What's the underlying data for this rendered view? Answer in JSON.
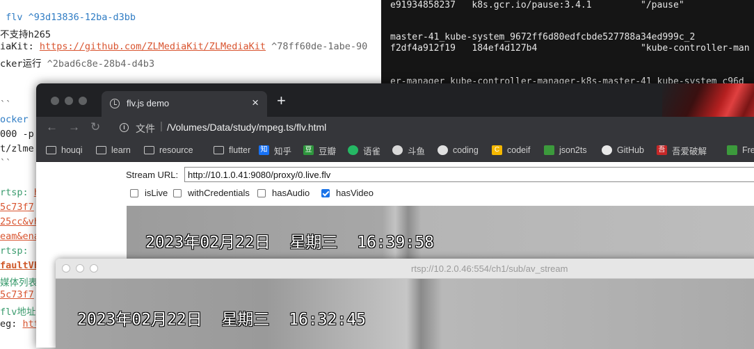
{
  "editor": {
    "lines": [
      {
        "segments": [
          {
            "text": " flv ^93d13836-12ba-d3bb",
            "style": "blue"
          }
        ]
      },
      {
        "segments": [
          {
            "text": "不支持h265",
            "style": "plain"
          }
        ]
      },
      {
        "segments": [
          {
            "text": "iaKit: ",
            "style": "plain"
          },
          {
            "text": "https://github.com/ZLMediaKit/ZLMediaKit",
            "style": "link"
          },
          {
            "text": " ^78ff60de-1abe-90",
            "style": "gray"
          }
        ]
      },
      {
        "segments": [
          {
            "text": "cker运行 ",
            "style": "plain"
          },
          {
            "text": "^2bad6c8e-28b4-d4b3",
            "style": "gray"
          }
        ]
      },
      {
        "segments": [
          {
            "text": "",
            "style": "plain"
          }
        ]
      },
      {
        "segments": [
          {
            "text": "",
            "style": "plain"
          }
        ]
      },
      {
        "segments": [
          {
            "text": "``",
            "style": "gray"
          }
        ]
      },
      {
        "segments": [
          {
            "text": "ocker",
            "style": "blue"
          }
        ]
      },
      {
        "segments": [
          {
            "text": "000 -p",
            "style": "plain"
          }
        ]
      },
      {
        "segments": [
          {
            "text": "t/zlme",
            "style": "plain"
          }
        ]
      },
      {
        "segments": [
          {
            "text": "``",
            "style": "gray"
          }
        ]
      },
      {
        "segments": [
          {
            "text": "",
            "style": "plain"
          }
        ]
      },
      {
        "segments": [
          {
            "text": "rtsp: ",
            "style": "green"
          },
          {
            "text": "h",
            "style": "link"
          }
        ]
      },
      {
        "segments": [
          {
            "text": "5c73f7",
            "style": "link"
          }
        ]
      },
      {
        "segments": [
          {
            "text": "25cc&vh",
            "style": "link"
          }
        ]
      },
      {
        "segments": [
          {
            "text": "eam&ena",
            "style": "link"
          }
        ]
      },
      {
        "segments": [
          {
            "text": "rtsp:",
            "style": "green"
          }
        ]
      },
      {
        "segments": [
          {
            "text": "faultVh",
            "style": "orange"
          }
        ]
      },
      {
        "segments": [
          {
            "text": "媒体列表",
            "style": "green"
          }
        ]
      },
      {
        "segments": [
          {
            "text": "5c73f7",
            "style": "link"
          }
        ]
      },
      {
        "segments": [
          {
            "text": "flv地址",
            "style": "green"
          }
        ]
      },
      {
        "segments": [
          {
            "text": "eg: ",
            "style": "plain"
          },
          {
            "text": "htt",
            "style": "link"
          }
        ]
      }
    ]
  },
  "terminal": {
    "lines": [
      "e91934858237   k8s.gcr.io/pause:3.4.1         \"/pause\"",
      "",
      "master-41_kube-system_9672ff6d80edfcbde527788a34ed999c_2",
      "f2df4a912f19   184ef4d127b4                   \"kube-controller-man",
      "",
      "er-manager_kube-controller-manager-k8s-master-41_kube-system_c96d"
    ]
  },
  "browser": {
    "tab_title": "flv.js demo",
    "tab_close": "×",
    "new_tab": "+",
    "nav": {
      "back": "←",
      "forward": "→",
      "reload": "↻"
    },
    "url_scheme": "文件",
    "url_separator": "|",
    "url": "/Volumes/Data/study/mpeg.ts/flv.html",
    "bookmarks": [
      {
        "label": "houqi",
        "icon": "folder-icon"
      },
      {
        "label": "learn",
        "icon": "folder-icon"
      },
      {
        "label": "resource",
        "icon": "folder-icon"
      },
      {
        "label": "flutter",
        "icon": "folder-icon"
      },
      {
        "label": "知乎",
        "icon": "zhihu-icon",
        "badge": "知",
        "color": "#1772f6"
      },
      {
        "label": "豆瓣",
        "icon": "douban-icon",
        "badge": "豆",
        "color": "#2e963d"
      },
      {
        "label": "语雀",
        "icon": "yuque-icon",
        "badge": "",
        "color": "#25b864"
      },
      {
        "label": "斗鱼",
        "icon": "douyu-icon",
        "badge": "",
        "color": "#d8d8d8"
      },
      {
        "label": "coding",
        "icon": "coding-icon",
        "badge": "",
        "color": "#e0e0e0"
      },
      {
        "label": "codeif",
        "icon": "codeif-icon",
        "badge": "C",
        "color": "#f5b800"
      },
      {
        "label": "json2ts",
        "icon": "json2ts-icon",
        "badge": "",
        "color": "#3c9a3c"
      },
      {
        "label": "GitHub",
        "icon": "github-icon",
        "badge": "",
        "color": "#e8e8e8"
      },
      {
        "label": "吾爱破解",
        "icon": "52pojie-icon",
        "badge": "吾",
        "color": "#c62828"
      },
      {
        "label": "Free",
        "icon": "free-icon",
        "badge": "",
        "color": "#3c9a3c"
      }
    ],
    "stream_url_label": "Stream URL:",
    "stream_url_value": "http://10.1.0.41:9080/proxy/0.live.flv",
    "options": [
      {
        "label": "isLive",
        "checked": false
      },
      {
        "label": "withCredentials",
        "checked": false
      },
      {
        "label": "hasAudio",
        "checked": false
      },
      {
        "label": "hasVideo",
        "checked": true
      }
    ],
    "video_osd": "2023年02月22日  星期三  16:39:58"
  },
  "rtsp_window": {
    "title": "rtsp://10.2.0.46:554/ch1/sub/av_stream",
    "video_osd": "2023年02月22日  星期三  16:32:45"
  }
}
